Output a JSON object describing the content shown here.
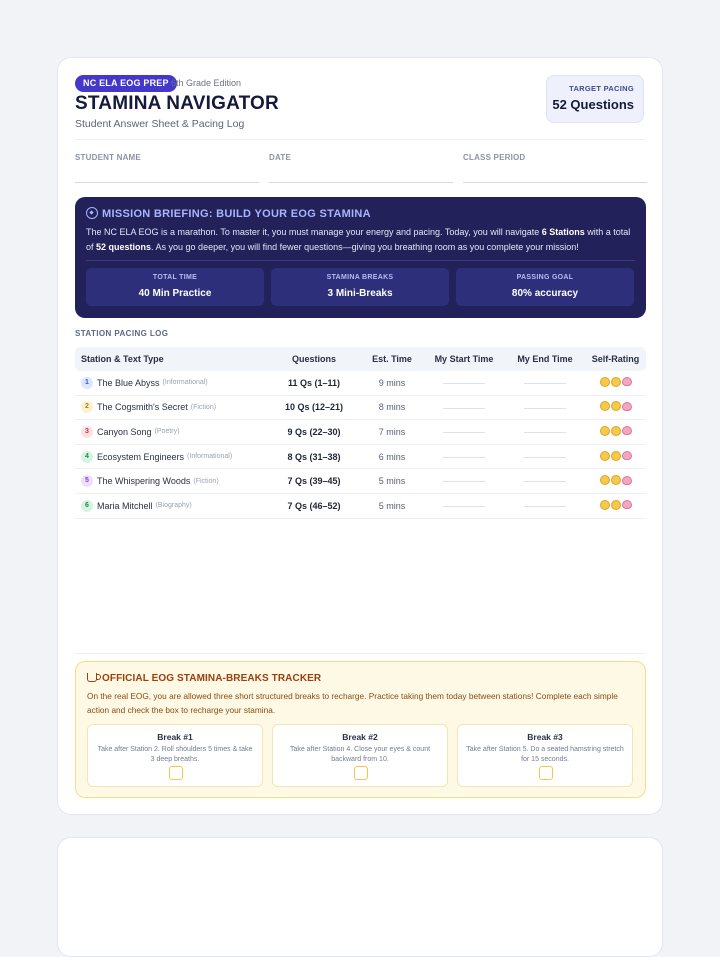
{
  "header": {
    "badge": "NC ELA EOG PREP",
    "edition": "6th Grade Edition",
    "title": "STAMINA NAVIGATOR",
    "subtitle": "Student Answer Sheet & Pacing Log",
    "target_label": "TARGET PACING",
    "target_value": "52 Questions"
  },
  "fields": [
    {
      "label": "STUDENT NAME"
    },
    {
      "label": "DATE"
    },
    {
      "label": "CLASS PERIOD"
    }
  ],
  "mission": {
    "heading": "MISSION BRIEFING: BUILD YOUR EOG STAMINA",
    "text_1": "The NC ELA EOG is a marathon. To master it, you must manage your energy and pacing. Today, you will navigate ",
    "text_bold_1": "6 Stations",
    "text_2": " with a total of ",
    "text_bold_2": "52 questions",
    "text_3": ". As you go deeper, you will find fewer questions—giving you breathing room as you complete your mission!",
    "stats": [
      {
        "label": "TOTAL TIME",
        "value": "40 Min Practice"
      },
      {
        "label": "STAMINA BREAKS",
        "value": "3 Mini-Breaks"
      },
      {
        "label": "PASSING GOAL",
        "value": "80% accuracy"
      }
    ]
  },
  "log": {
    "title": "STATION PACING LOG",
    "columns": [
      "Station & Text Type",
      "Questions",
      "Est. Time",
      "My Start Time",
      "My End Time",
      "Self-Rating"
    ],
    "rows": [
      {
        "num": "1",
        "name": "The Blue Abyss",
        "type": "(Informational)",
        "questions": "11 Qs (1–11)",
        "est": "9 mins",
        "badge_bg": "#dbe7fe",
        "badge_fg": "#2b5bd7"
      },
      {
        "num": "2",
        "name": "The Cogsmith's Secret",
        "type": "(Fiction)",
        "questions": "10 Qs (12–21)",
        "est": "8 mins",
        "badge_bg": "#fdf0cf",
        "badge_fg": "#b7791f"
      },
      {
        "num": "3",
        "name": "Canyon Song",
        "type": "(Poetry)",
        "questions": "9 Qs (22–30)",
        "est": "7 mins",
        "badge_bg": "#fde0e3",
        "badge_fg": "#c53045"
      },
      {
        "num": "4",
        "name": "Ecosystem Engineers",
        "type": "(Informational)",
        "questions": "8 Qs (31–38)",
        "est": "6 mins",
        "badge_bg": "#d5f3e2",
        "badge_fg": "#1f8a4c"
      },
      {
        "num": "5",
        "name": "The Whispering Woods",
        "type": "(Fiction)",
        "questions": "7 Qs (39–45)",
        "est": "5 mins",
        "badge_bg": "#ece0fb",
        "badge_fg": "#7c3aed"
      },
      {
        "num": "6",
        "name": "Maria Mitchell",
        "type": "(Biography)",
        "questions": "7 Qs (46–52)",
        "est": "5 mins",
        "badge_bg": "#d5f3e2",
        "badge_fg": "#1f8a4c"
      }
    ]
  },
  "breaks": {
    "heading": "OFFICIAL EOG STAMINA-BREAKS TRACKER",
    "text": "On the real EOG, you are allowed three short structured breaks to recharge. Practice taking them today between stations! Complete each simple action and check the box to recharge your stamina.",
    "items": [
      {
        "title": "Break #1",
        "desc": "Take after Station 2. Roll shoulders 5 times & take 3 deep breaths."
      },
      {
        "title": "Break #2",
        "desc": "Take after Station 4. Close your eyes & count backward from 10."
      },
      {
        "title": "Break #3",
        "desc": "Take after Station 5. Do a seated hamstring stretch for 15 seconds."
      }
    ]
  }
}
